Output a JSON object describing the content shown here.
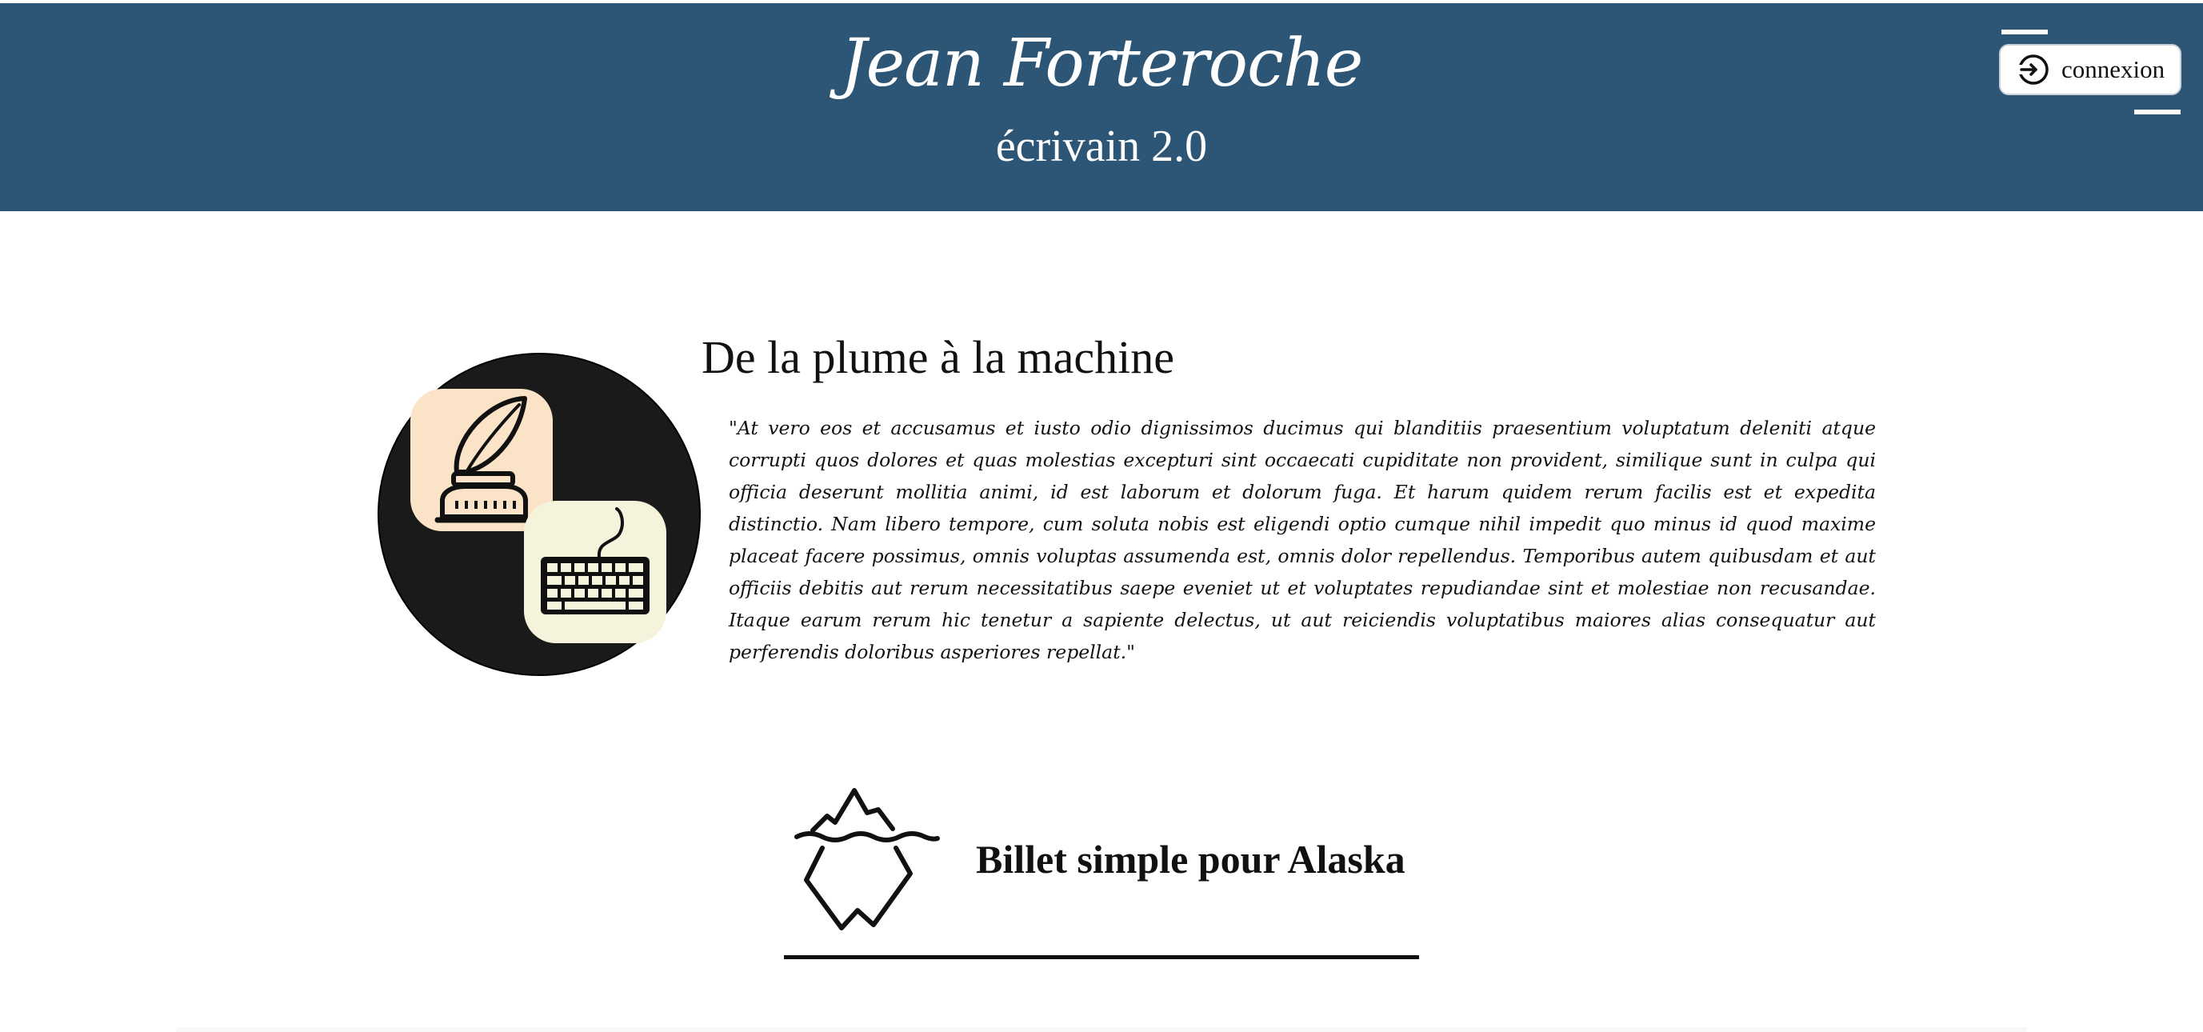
{
  "header": {
    "site_title": "Jean Forteroche",
    "site_subtitle": "écrivain 2.0",
    "background_color": "#2d5676",
    "login_button": {
      "label": "connexion",
      "icon": "login-icon"
    }
  },
  "intro": {
    "heading": "De la plume à la machine",
    "quote": "\"At vero eos et accusamus et iusto odio dignissimos ducimus qui blanditiis praesentium voluptatum deleniti atque corrupti quos dolores et quas molestias excepturi sint occaecati cupiditate non provident, similique sunt in culpa qui officia deserunt mollitia animi, id est laborum et dolorum fuga. Et harum quidem rerum facilis est et expedita distinctio. Nam libero tempore, cum soluta nobis est eligendi optio cumque nihil impedit quo minus id quod maxime placeat facere possimus, omnis voluptas assumenda est, omnis dolor repellendus. Temporibus autem quibusdam et aut officiis debitis aut rerum necessitatibus saepe eveniet ut et voluptates repudiandae sint et molestiae non recusandae. Itaque earum rerum hic tenetur a sapiente delectus, ut aut reiciendis voluptatibus maiores alias consequatur aut perferendis doloribus asperiores repellat.\"",
    "illustration": {
      "icons": [
        "quill-inkwell-icon",
        "keyboard-icon"
      ],
      "circle_color": "#1a1a1a",
      "tile_colors": [
        "#fbe3c8",
        "#f6f3dc"
      ]
    }
  },
  "articles": [
    {
      "title": "Billet simple pour Alaska",
      "icon": "iceberg-icon"
    }
  ]
}
